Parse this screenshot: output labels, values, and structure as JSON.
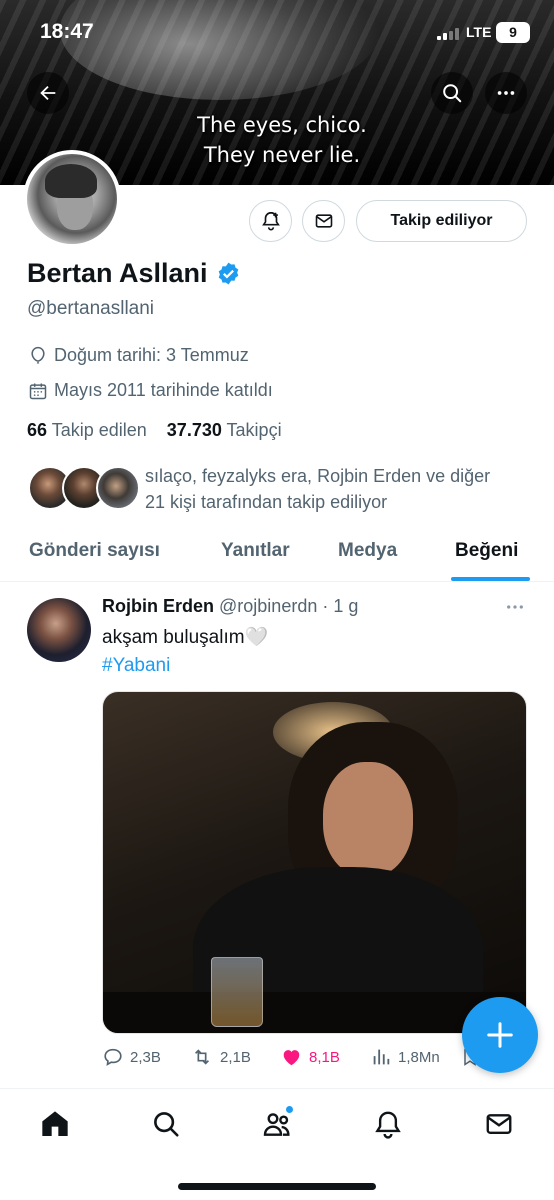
{
  "status_bar": {
    "time": "18:47",
    "network": "LTE",
    "battery": "9"
  },
  "banner": {
    "caption_line1": "The eyes, chico.",
    "caption_line2": "They never lie."
  },
  "profile": {
    "name": "Bertan Asllani",
    "handle": "@bertanasllani",
    "birthday": "Doğum tarihi: 3 Temmuz",
    "joined": "Mayıs 2011 tarihinde katıldı",
    "following_count": "66",
    "following_label": "Takip edilen",
    "followers_count": "37.730",
    "followers_label": "Takipçi",
    "followed_by_line1": "sılaço, feyzalyks era, Rojbin Erden ve diğer",
    "followed_by_line2": "21 kişi tarafından takip ediliyor",
    "follow_button": "Takip ediliyor"
  },
  "tabs": [
    {
      "label": "Gönderi sayısı",
      "active": false
    },
    {
      "label": "Yanıtlar",
      "active": false
    },
    {
      "label": "Medya",
      "active": false
    },
    {
      "label": "Beğeni",
      "active": true
    }
  ],
  "tweet": {
    "author": "Rojbin Erden",
    "handle": "@rojbinerdn",
    "time": "· 1 g",
    "text": "akşam buluşalım🤍",
    "hashtag": "#Yabani",
    "replies": "2,3B",
    "retweets": "2,1B",
    "likes": "8,1B",
    "views": "1,8Mn"
  },
  "colors": {
    "accent": "#1d9bf0",
    "like": "#f91880",
    "secondary_text": "#536471"
  },
  "icons": [
    "back-arrow-icon",
    "search-icon",
    "more-icon",
    "notification-bell-icon",
    "message-icon",
    "verified-badge-icon",
    "balloon-icon",
    "calendar-icon",
    "reply-icon",
    "retweet-icon",
    "heart-icon",
    "views-icon",
    "bookmark-icon",
    "compose-plus-icon",
    "home-icon",
    "communities-icon",
    "bell-icon",
    "mail-icon"
  ]
}
